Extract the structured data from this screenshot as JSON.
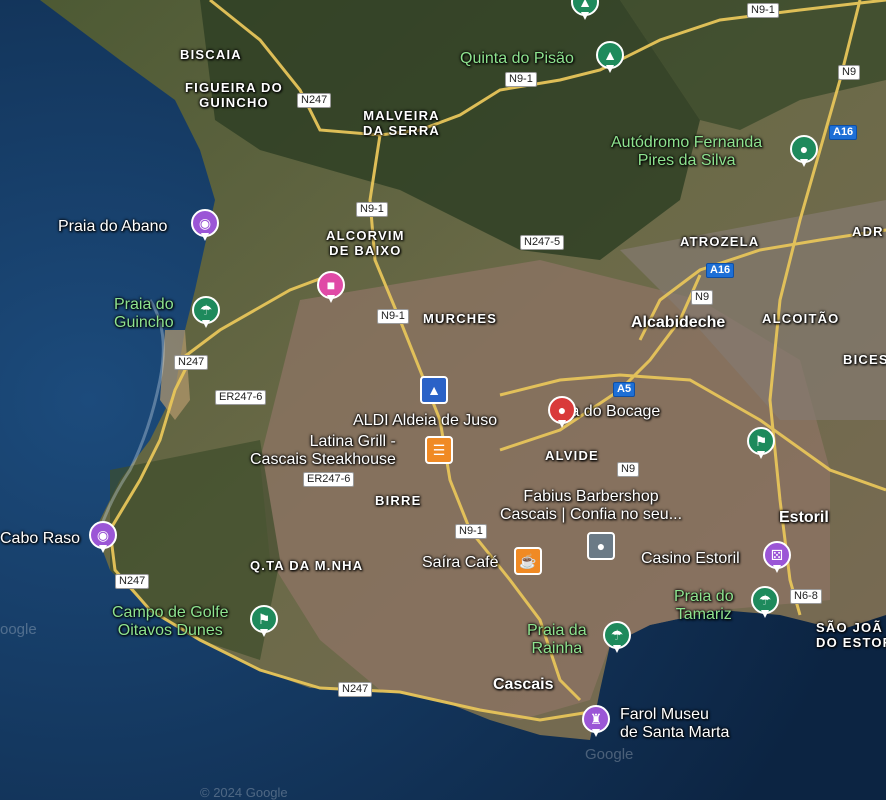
{
  "colors": {
    "ocean": "#163a66",
    "ocean_deep": "#0d2746",
    "land": "#6f6a44",
    "urban": "#9a7b67",
    "forest": "#2d3d22",
    "road_yellow": "#e7c55a",
    "pin_green": "#1e8a5c",
    "pin_purple": "#9b56d6",
    "pin_pink": "#e04aa6",
    "pin_red": "#d93a3a",
    "pin_orange": "#f08a24",
    "pin_gray": "#6b7a86"
  },
  "places": {
    "biscaia": "BISCAIA",
    "figueira": "FIGUEIRA DO\nGUINCHO",
    "malveira": "MALVEIRA\nDA SERRA",
    "alcorvim": "ALCORVIM\nDE BAIXO",
    "murches": "MURCHES",
    "atrozela": "ATROZELA",
    "adr": "ADR",
    "alcabideche": "Alcabideche",
    "alcoitao": "ALCOITÃO",
    "bices": "BICES",
    "alvide": "ALVIDE",
    "birre": "BIRRE",
    "qta": "Q.TA DA M.NHA",
    "estoril": "Estoril",
    "sao_joao": "SÃO JOÃ\nDO ESTOR",
    "cascais": "Cascais"
  },
  "pois": {
    "quinta_pisao": "Quinta do Pisão",
    "autodromo": "Autódromo Fernanda\nPires da Silva",
    "praia_abano": "Praia do Abano",
    "praia_guincho": "Praia do\nGuincho",
    "aldi": "ALDI Aldeia de Juso",
    "latina": "Latina Grill -\nCascais Steakhouse",
    "rua_bocage": "Rua do Bocage",
    "fabius": "Fabius Barbershop\nCascais | Confia no seu...",
    "cabo_raso": "Cabo Raso",
    "saira": "Saíra Café",
    "casino": "Casino Estoril",
    "praia_tamariz": "Praia do\nTamariz",
    "campo_golfe": "Campo de Golfe\nOitavos Dunes",
    "praia_rainha": "Praia da\nRainha",
    "farol": "Farol Museu\nde Santa Marta"
  },
  "roads": {
    "n9_1_top": "N9-1",
    "n9_1_mid": "N9-1",
    "n9_top": "N9",
    "n247_top": "N247",
    "a16_top": "A16",
    "n9_1_a": "N9-1",
    "n247_5": "N247-5",
    "a16_mid": "A16",
    "n9_mid": "N9",
    "n9_1_b": "N9-1",
    "n247_left": "N247",
    "er247_6_a": "ER247-6",
    "a5": "A5",
    "n9_low": "N9",
    "er247_6_b": "ER247-6",
    "n9_1_c": "N9-1",
    "n247_bl": "N247",
    "n6_8": "N6-8",
    "n247_bottom": "N247"
  },
  "watermarks": {
    "copyright_bottom": "© 2024 Google",
    "google_faint": "Google",
    "google_left": "oogle"
  },
  "icons": {
    "tree": "tree-icon",
    "camera": "camera-icon",
    "hotel": "bed-icon",
    "beach": "beach-umbrella-icon",
    "restaurant": "fork-knife-icon",
    "pin_location": "map-pin-icon",
    "golf": "golf-icon",
    "cafe": "coffee-cup-icon",
    "casino": "dice-icon",
    "monument": "tower-icon",
    "venue": "location-dot-icon",
    "store": "shopping-icon"
  }
}
